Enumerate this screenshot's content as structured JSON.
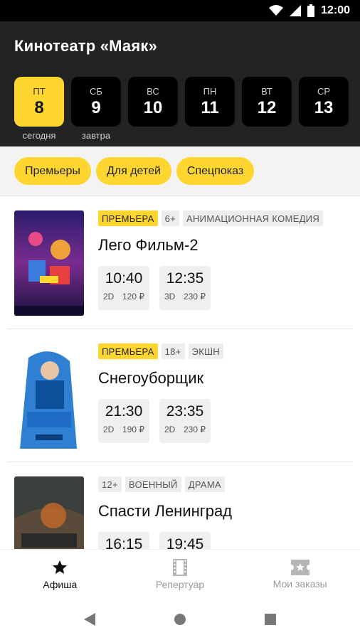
{
  "status_bar": {
    "time": "12:00"
  },
  "header": {
    "title": "Кинотеатр «Маяк»"
  },
  "days": [
    {
      "dow": "ПТ",
      "num": "8",
      "sub": "сегодня",
      "active": true
    },
    {
      "dow": "СБ",
      "num": "9",
      "sub": "завтра",
      "active": false
    },
    {
      "dow": "ВС",
      "num": "10",
      "sub": "",
      "active": false
    },
    {
      "dow": "ПН",
      "num": "11",
      "sub": "",
      "active": false
    },
    {
      "dow": "ВТ",
      "num": "12",
      "sub": "",
      "active": false
    },
    {
      "dow": "СР",
      "num": "13",
      "sub": "",
      "active": false
    }
  ],
  "filters": [
    "Премьеры",
    "Для детей",
    "Спецпоказ"
  ],
  "movies": [
    {
      "tags": [
        "ПРЕМЬЕРА",
        "6+",
        "АНИМАЦИОННАЯ КОМЕДИЯ"
      ],
      "title": "Лего Фильм-2",
      "sessions": [
        {
          "time": "10:40",
          "format": "2D",
          "price": "120 ₽"
        },
        {
          "time": "12:35",
          "format": "3D",
          "price": "230 ₽"
        }
      ]
    },
    {
      "tags": [
        "ПРЕМЬЕРА",
        "18+",
        "ЭКШН"
      ],
      "title": "Снегоуборщик",
      "sessions": [
        {
          "time": "21:30",
          "format": "2D",
          "price": "190 ₽"
        },
        {
          "time": "23:35",
          "format": "2D",
          "price": "230 ₽"
        }
      ]
    },
    {
      "tags": [
        "12+",
        "ВОЕННЫЙ",
        "ДРАМА"
      ],
      "title": "Спасти Ленинград",
      "sessions": [
        {
          "time": "16:15",
          "format": "",
          "price": ""
        },
        {
          "time": "19:45",
          "format": "",
          "price": ""
        }
      ]
    }
  ],
  "bottom_nav": [
    {
      "label": "Афиша",
      "icon": "star-icon",
      "active": true
    },
    {
      "label": "Репертуар",
      "icon": "film-icon",
      "active": false
    },
    {
      "label": "Мои заказы",
      "icon": "ticket-icon",
      "active": false
    }
  ],
  "colors": {
    "accent": "#ffd530",
    "header_bg": "#232323"
  }
}
